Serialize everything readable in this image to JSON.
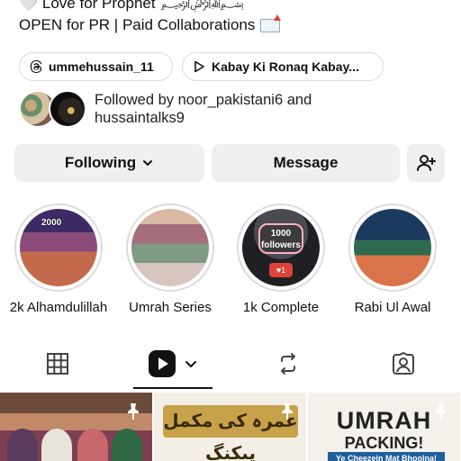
{
  "bio": {
    "line1": "🤍 Love for Prophet",
    "line2": "OPEN for PR | Paid Collaborations"
  },
  "links": {
    "threads": "ummehussain_11",
    "music": "Kabay Ki Ronaq Kabay..."
  },
  "followed_by": {
    "line1": "Followed by noor_pakistani6 and",
    "line2": "hussaintalks9"
  },
  "actions": {
    "following": "Following",
    "message": "Message"
  },
  "highlights": [
    {
      "label": "2k Alhamdulillah",
      "badge": "2000"
    },
    {
      "label": "Umrah Series"
    },
    {
      "label": "1k Complete",
      "badge_line1": "1000",
      "badge_line2": "followers",
      "heart": "♥1"
    },
    {
      "label": "Rabi Ul Awal"
    }
  ],
  "posts": [
    {
      "title": ""
    },
    {
      "title": "عمرہ کی مکمل پیکنگ",
      "subtitle": ""
    },
    {
      "title": "UMRAH",
      "title2": "PACKING!",
      "subtitle": "Ye Cheezein Mat Bhoolna!"
    }
  ],
  "colors": {
    "button_bg": "#efefef",
    "border": "#dbdbdb",
    "text": "#111111",
    "badge_red": "#e0413b"
  }
}
